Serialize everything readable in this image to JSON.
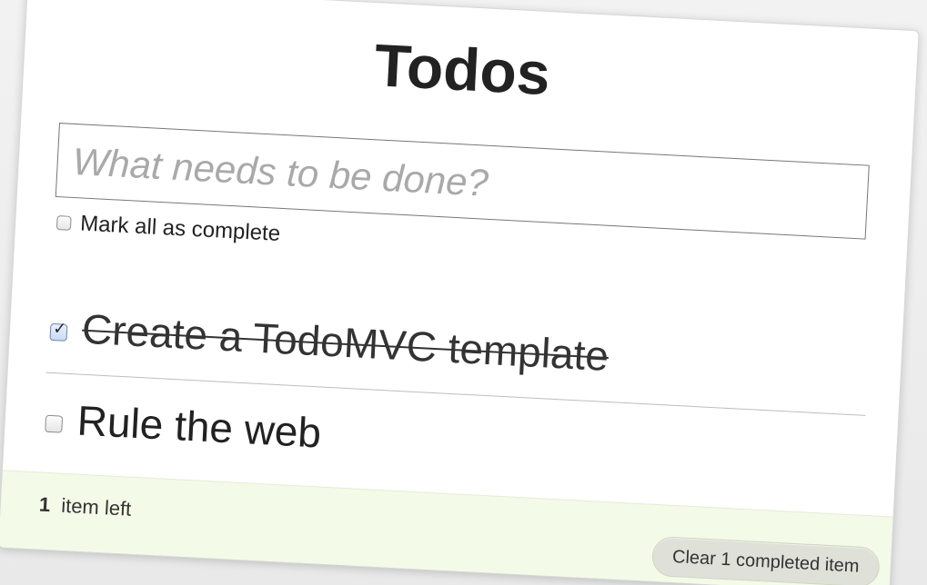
{
  "app": {
    "title": "Todos"
  },
  "new_todo": {
    "placeholder": "What needs to be done?",
    "value": ""
  },
  "toggle_all": {
    "label": "Mark all as complete",
    "checked": false
  },
  "todos": [
    {
      "text": "Create a TodoMVC template",
      "completed": true
    },
    {
      "text": "Rule the web",
      "completed": false
    }
  ],
  "footer": {
    "count": "1",
    "count_label": "item left",
    "clear_label": "Clear 1 completed item"
  },
  "colors": {
    "footer_background": "#f4fae8",
    "completed_checkbox": "#6b84aa",
    "title_text": "#222222"
  }
}
